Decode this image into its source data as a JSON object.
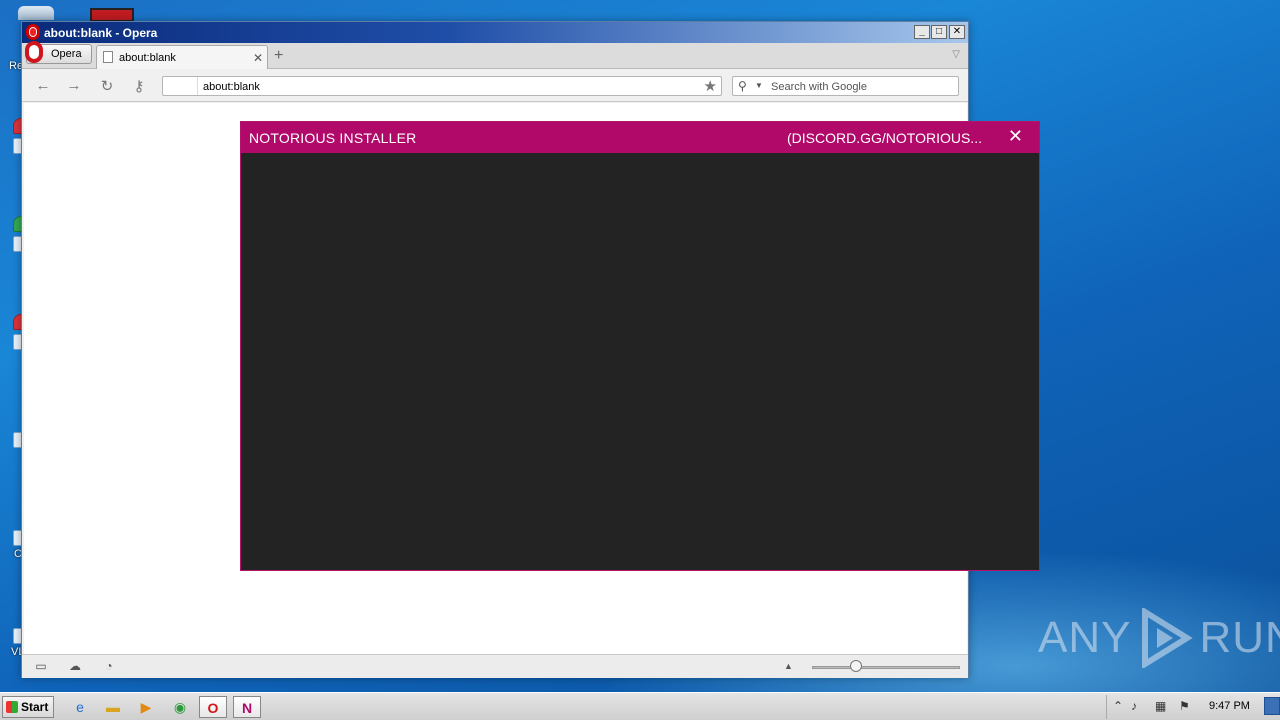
{
  "desktop": {
    "label_fragments": [
      "Re",
      "C",
      "C",
      "VL"
    ],
    "watermark_left": "ANY",
    "watermark_right": "RUN"
  },
  "browser": {
    "window_title": "about:blank - Opera",
    "controls": {
      "minimize": "_",
      "maximize": "□",
      "close": "✕"
    },
    "menu_label": "Opera",
    "tab": {
      "title": "about:blank",
      "close": "✕"
    },
    "new_tab": "+",
    "tab_menu": "▽",
    "nav": {
      "back": "←",
      "forward": "→",
      "reload": "↻",
      "key": "⚷"
    },
    "address": {
      "value": "about:blank",
      "star": "★"
    },
    "search": {
      "placeholder": "Search with Google",
      "icon": "⚲",
      "drop": "▼"
    },
    "statusbar": {
      "panel": "▭",
      "cloud": "☁",
      "speed": "◔",
      "zoom_up": "▲",
      "zoom_level": 0.3
    }
  },
  "installer": {
    "title": "NOTORIOUS INSTALLER",
    "subtitle": "(DISCORD.GG/NOTORIOUS...",
    "close": "✕",
    "accent": "#b1096a",
    "body_color": "#232323"
  },
  "taskbar": {
    "start_label": "Start",
    "apps": [
      "ie-icon",
      "explorer-icon",
      "media-player-icon",
      "chrome-icon",
      "opera-icon",
      "installer-icon"
    ],
    "clock": "9:47 PM"
  }
}
